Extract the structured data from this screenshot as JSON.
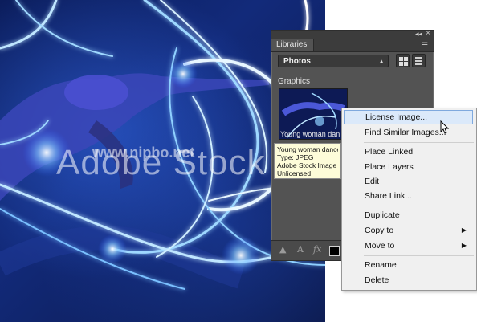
{
  "watermark": {
    "brand": "Adobe Stock",
    "url": "www.nipbo.net"
  },
  "panel": {
    "tab_label": "Libraries",
    "library_select": "Photos",
    "section_label": "Graphics",
    "thumbnail_caption": "Young woman dan",
    "tooltip": {
      "line1": "Young woman dance",
      "line2": "Type: JPEG",
      "line3": "Adobe Stock Image",
      "line4": "Unlicensed"
    },
    "icons": [
      "collapse-icon",
      "close-icon",
      "panel-menu-icon",
      "grid-view-icon",
      "list-view-icon",
      "stock-icon",
      "text-icon",
      "fx-icon",
      "color-swatch-icon"
    ]
  },
  "context_menu": {
    "items": [
      {
        "label": "License Image...",
        "highlighted": true
      },
      {
        "label": "Find Similar Images..."
      },
      {
        "label": "Place Linked"
      },
      {
        "label": "Place Layers"
      },
      {
        "label": "Edit"
      },
      {
        "label": "Share Link..."
      },
      {
        "label": "Duplicate"
      },
      {
        "label": "Copy to",
        "submenu": true
      },
      {
        "label": "Move to",
        "submenu": true
      },
      {
        "label": "Rename"
      },
      {
        "label": "Delete"
      }
    ]
  },
  "colors": {
    "panel_bg": "#535353",
    "menu_bg": "#f0f0f0",
    "highlight": "#dbe9fa",
    "tooltip_bg": "#fdfcd9"
  }
}
